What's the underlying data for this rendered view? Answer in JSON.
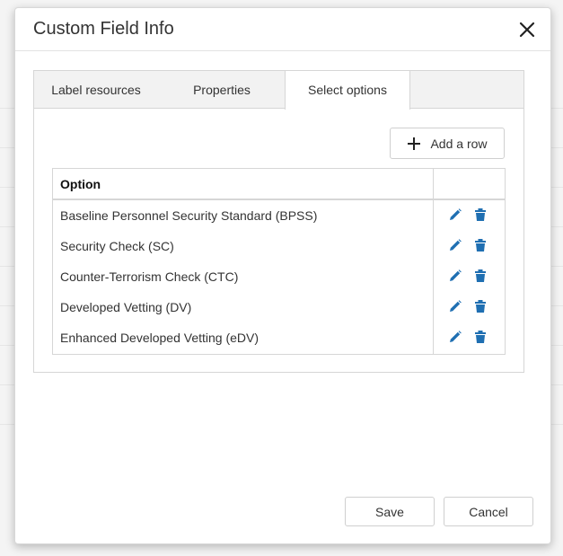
{
  "dialog": {
    "title": "Custom Field Info",
    "close_icon": "close-icon"
  },
  "tabs": [
    {
      "label": "Label resources",
      "active": false
    },
    {
      "label": "Properties",
      "active": false
    },
    {
      "label": "Select options",
      "active": true
    }
  ],
  "toolbar": {
    "add_row_label": "Add a row",
    "add_icon": "plus-icon"
  },
  "grid": {
    "columns": [
      "Option"
    ],
    "rows": [
      {
        "option": "Baseline Personnel Security Standard (BPSS)"
      },
      {
        "option": "Security Check (SC)"
      },
      {
        "option": "Counter-Terrorism Check (CTC)"
      },
      {
        "option": "Developed Vetting (DV)"
      },
      {
        "option": "Enhanced Developed Vetting (eDV)"
      }
    ],
    "row_icons": [
      "pencil-icon",
      "trash-icon"
    ]
  },
  "footer": {
    "save_label": "Save",
    "cancel_label": "Cancel"
  },
  "colors": {
    "icon_blue": "#1f6fb2"
  }
}
